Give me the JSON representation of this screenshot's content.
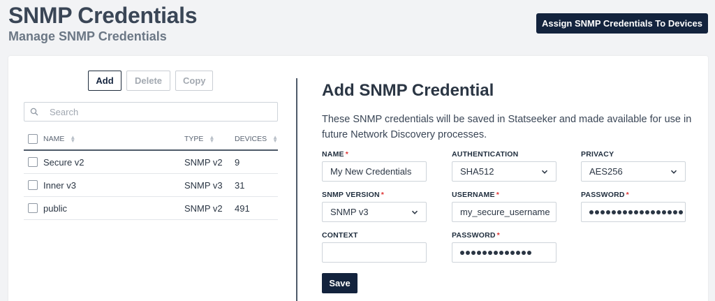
{
  "header": {
    "title": "SNMP Credentials",
    "subtitle": "Manage SNMP Credentials",
    "assign_label": "Assign SNMP Credentials To Devices"
  },
  "list": {
    "toolbar": {
      "add": "Add",
      "delete": "Delete",
      "copy": "Copy"
    },
    "search_placeholder": "Search",
    "columns": {
      "name": "NAME",
      "type": "TYPE",
      "devices": "DEVICES"
    },
    "rows": [
      {
        "name": "Secure v2",
        "type": "SNMP v2",
        "devices": "9"
      },
      {
        "name": "Inner v3",
        "type": "SNMP v3",
        "devices": "31"
      },
      {
        "name": "public",
        "type": "SNMP v2",
        "devices": "491"
      }
    ]
  },
  "form": {
    "title": "Add SNMP Credential",
    "description": "These SNMP credentials will be saved in Statseeker and made available for use in future Network Discovery processes.",
    "name_label": "NAME",
    "name_value": "My New Credentials",
    "auth_label": "AUTHENTICATION",
    "auth_value": "SHA512",
    "privacy_label": "PRIVACY",
    "privacy_value": "AES256",
    "version_label": "SNMP VERSION",
    "version_value": "SNMP v3",
    "username_label": "USERNAME",
    "username_value": "my_secure_username",
    "password_label": "PASSWORD",
    "password_length": 17,
    "context_label": "CONTEXT",
    "context_value": "",
    "auth_password_label": "PASSWORD",
    "auth_password_length": 13,
    "required_marker": "*",
    "save_label": "Save"
  },
  "colors": {
    "primary": "#13233d",
    "required": "#dd3333",
    "background": "#f2f3f5"
  }
}
